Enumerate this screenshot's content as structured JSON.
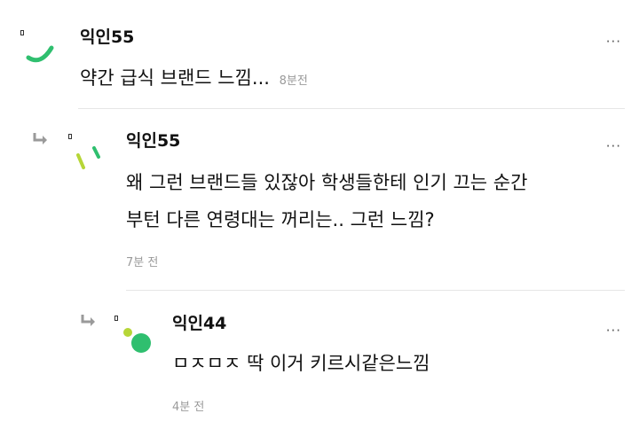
{
  "comments": [
    {
      "author": "익인55",
      "body": "약간 급식 브랜드 느낌...",
      "time": "8분전",
      "more": "···"
    },
    {
      "author": "익인55",
      "body_line1": "왜 그런 브랜드들 있잖아 학생들한테 인기 끄는 순간",
      "body_line2": "부턴 다른 연령대는 꺼리는.. 그런 느낌?",
      "time": "7분 전",
      "more": "···"
    },
    {
      "author": "익인44",
      "body": "ㅁㅈㅁㅈ 딱 이거 키르시같은느낌",
      "time": "4분 전",
      "more": "···"
    }
  ],
  "colors": {
    "accent_green": "#2fbf6f",
    "lime": "#b6d637",
    "muted": "#9a9a9a"
  },
  "icons": [
    "reply-arrow-icon",
    "avatar-icon",
    "more-icon"
  ]
}
